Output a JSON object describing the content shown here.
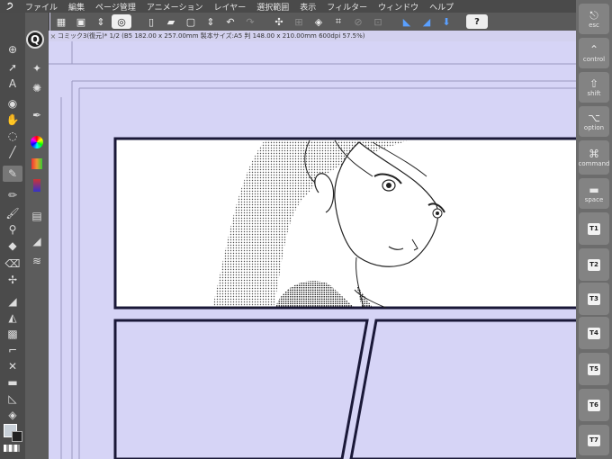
{
  "menu": {
    "items": [
      "ファイル",
      "編集",
      "ページ管理",
      "アニメーション",
      "レイヤー",
      "選択範囲",
      "表示",
      "フィルター",
      "ウィンドウ",
      "ヘルプ"
    ]
  },
  "document_tab": {
    "title": "コミック3(復元)* 1/2 (B5 182.00 x 257.00mm 製本サイズ:A5 判 148.00 x 210.00mm 600dpi 57.5%)",
    "close_label": "×"
  },
  "edge_keys": [
    {
      "label": "esc",
      "glyph": "⎋"
    },
    {
      "label": "control",
      "glyph": "⌃"
    },
    {
      "label": "shift",
      "glyph": "⇧"
    },
    {
      "label": "option",
      "glyph": "⌥"
    },
    {
      "label": "command",
      "glyph": "⌘"
    },
    {
      "label": "space",
      "glyph": "▬"
    },
    {
      "label": "T1"
    },
    {
      "label": "T2"
    },
    {
      "label": "T3"
    },
    {
      "label": "T4"
    },
    {
      "label": "T5"
    },
    {
      "label": "T6"
    },
    {
      "label": "T7"
    }
  ],
  "toolbar": {
    "help_label": "?"
  },
  "colors": {
    "main_color": "#c8d0d8",
    "sub_color": "#222222",
    "canvas_bg": "#d6d4f6",
    "panel_border": "#1a1838"
  }
}
